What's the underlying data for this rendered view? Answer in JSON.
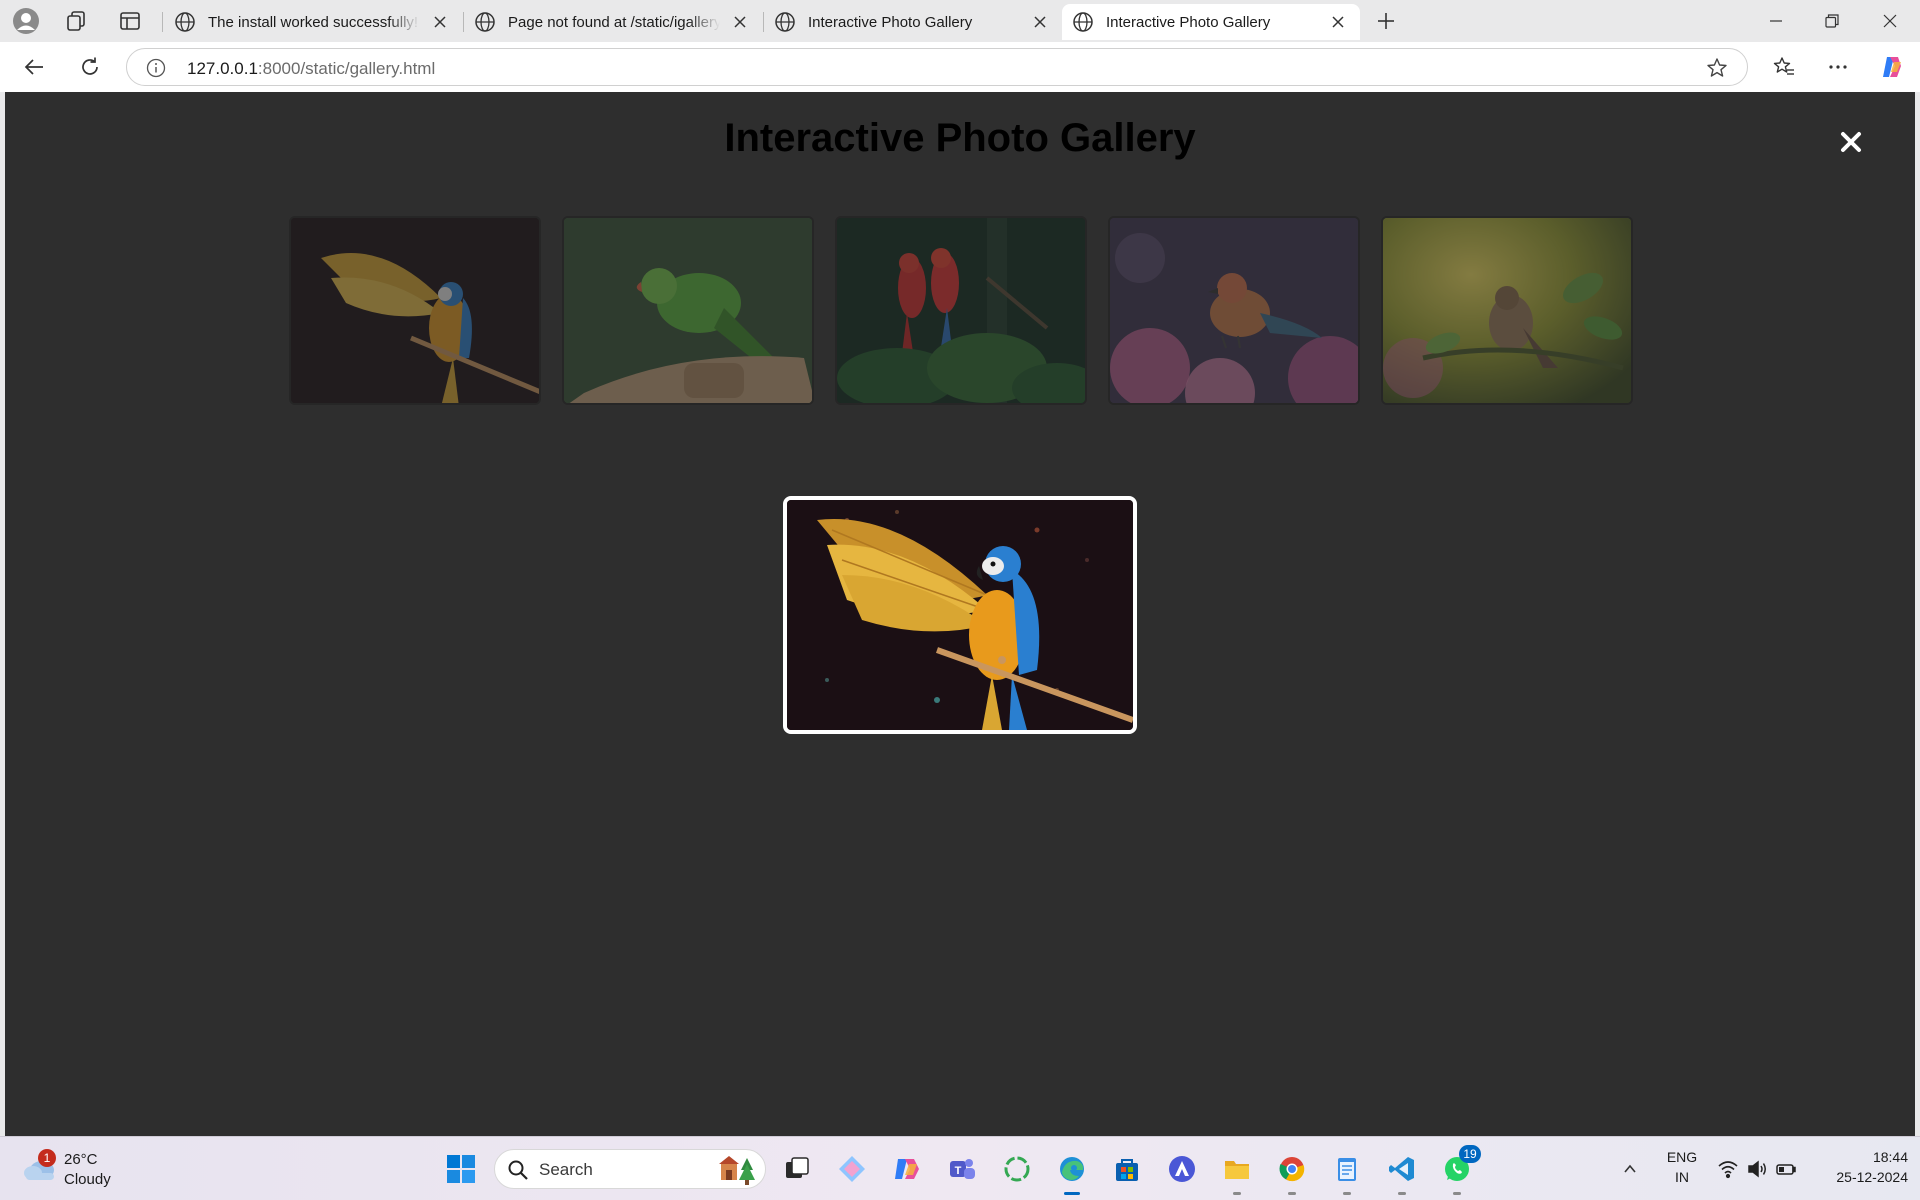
{
  "browser": {
    "tabs": [
      {
        "title": "The install worked successfully! Co",
        "active": false
      },
      {
        "title": "Page not found at /static/igallery.h",
        "active": false
      },
      {
        "title": "Interactive Photo Gallery",
        "active": false
      },
      {
        "title": "Interactive Photo Gallery",
        "active": true
      }
    ],
    "address": {
      "host": "127.0.0.1",
      "path": ":8000/static/gallery.html"
    }
  },
  "page": {
    "title": "Interactive Photo Gallery",
    "thumbnails": [
      {
        "subject": "blue-and-gold macaw spreading wings"
      },
      {
        "subject": "green parakeet on a perch"
      },
      {
        "subject": "two scarlet macaws in foliage"
      },
      {
        "subject": "small bird among pink flowers"
      },
      {
        "subject": "sparrow on a leafy branch"
      }
    ],
    "lightbox": {
      "subject": "blue-and-gold macaw spreading wings"
    }
  },
  "taskbar": {
    "weather": {
      "badge": "1",
      "temp": "26°C",
      "condition": "Cloudy"
    },
    "search_label": "Search",
    "whatsapp_badge": "19",
    "lang": {
      "line1": "ENG",
      "line2": "IN"
    },
    "clock": {
      "time": "18:44",
      "date": "25-12-2024"
    }
  },
  "colors": {
    "page_background": "#2e2e2e",
    "lightbox_border": "#ffffff",
    "taskbar_accent": "#0067c0"
  }
}
